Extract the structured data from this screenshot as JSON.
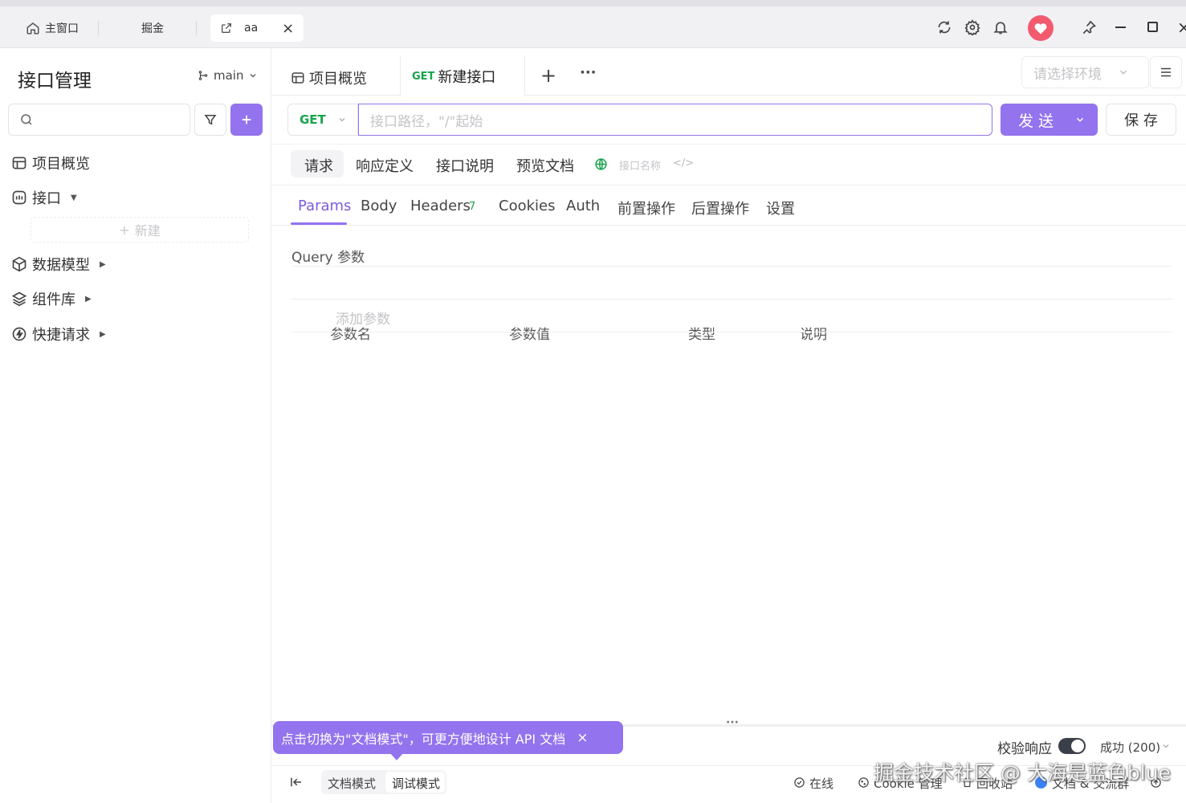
{
  "window": {
    "tabs": [
      {
        "label": "主窗口",
        "icon": "home-icon"
      },
      {
        "label": "掘金"
      },
      {
        "label": "aa",
        "icon": "external-link-icon"
      }
    ],
    "close_tab_glyph": "×",
    "controls": [
      "refresh-icon",
      "settings-icon",
      "bell-icon",
      "heart-avatar",
      "pin-icon",
      "minimize-icon",
      "maximize-icon",
      "close-icon"
    ]
  },
  "sidebar": {
    "title": "接口管理",
    "branch": "main",
    "search_placeholder": "",
    "new_label": "新建",
    "items": [
      {
        "label": "项目概览",
        "icon": "overview-icon"
      },
      {
        "label": "接口",
        "icon": "api-icon"
      },
      {
        "label": "数据模型",
        "icon": "cube-icon"
      },
      {
        "label": "组件库",
        "icon": "layers-icon"
      },
      {
        "label": "快捷请求",
        "icon": "bolt-icon"
      }
    ]
  },
  "tabs": {
    "overview": "项目概览",
    "new_method": "GET",
    "new_label": "新建接口",
    "add": "+",
    "more": "···",
    "env_placeholder": "请选择环境"
  },
  "request": {
    "method": "GET",
    "path_placeholder": "接口路径，\"/\"起始",
    "send_label": "发 送",
    "save_label": "保 存"
  },
  "sections": [
    "请求",
    "响应定义",
    "接口说明",
    "预览文档"
  ],
  "interface_name_placeholder": "接口名称",
  "param_tabs": [
    {
      "label": "Params",
      "active": true
    },
    {
      "label": "Body"
    },
    {
      "label": "Headers",
      "count": "7"
    },
    {
      "label": "Cookies"
    },
    {
      "label": "Auth"
    },
    {
      "label": "前置操作"
    },
    {
      "label": "后置操作"
    },
    {
      "label": "设置"
    }
  ],
  "query": {
    "title": "Query 参数",
    "columns": [
      "参数名",
      "参数值",
      "类型",
      "说明"
    ],
    "add_placeholder": "添加参数"
  },
  "response": {
    "validate_label": "校验响应",
    "validate_on": true,
    "status": "成功 (200)"
  },
  "tooltip": {
    "text": "点击切换为\"文档模式\"，可更方便地设计 API 文档",
    "close": "×"
  },
  "footer": {
    "modes": [
      "文档模式",
      "调试模式"
    ],
    "online": "在线",
    "cookie": "Cookie 管理",
    "recycle": "回收站",
    "docs": "文档 & 交流群"
  },
  "watermark": "掘金技术社区 @ 大海是蓝色blue",
  "colors": {
    "accent": "#9373ee",
    "get_green": "#17a34a",
    "active_tab_text": "#7c5cdb"
  }
}
